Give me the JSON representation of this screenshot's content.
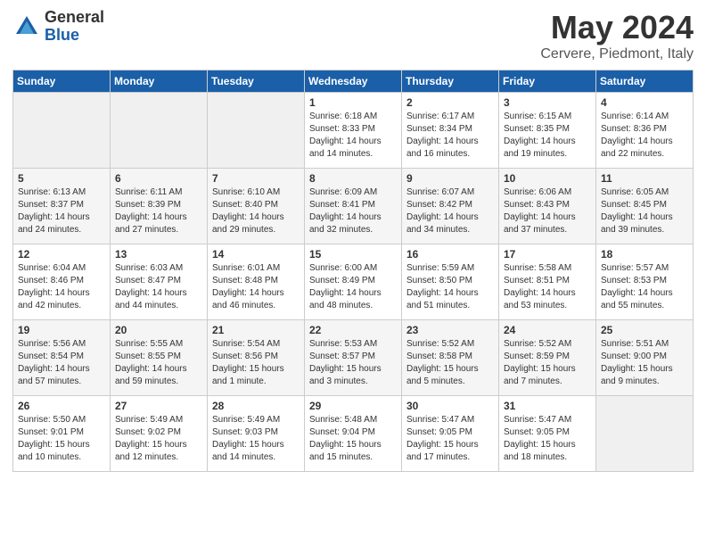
{
  "logo": {
    "general": "General",
    "blue": "Blue"
  },
  "header": {
    "month": "May 2024",
    "location": "Cervere, Piedmont, Italy"
  },
  "weekdays": [
    "Sunday",
    "Monday",
    "Tuesday",
    "Wednesday",
    "Thursday",
    "Friday",
    "Saturday"
  ],
  "weeks": [
    [
      {
        "day": "",
        "sunrise": "",
        "sunset": "",
        "daylight": "",
        "empty": true
      },
      {
        "day": "",
        "sunrise": "",
        "sunset": "",
        "daylight": "",
        "empty": true
      },
      {
        "day": "",
        "sunrise": "",
        "sunset": "",
        "daylight": "",
        "empty": true
      },
      {
        "day": "1",
        "sunrise": "Sunrise: 6:18 AM",
        "sunset": "Sunset: 8:33 PM",
        "daylight": "Daylight: 14 hours and 14 minutes."
      },
      {
        "day": "2",
        "sunrise": "Sunrise: 6:17 AM",
        "sunset": "Sunset: 8:34 PM",
        "daylight": "Daylight: 14 hours and 16 minutes."
      },
      {
        "day": "3",
        "sunrise": "Sunrise: 6:15 AM",
        "sunset": "Sunset: 8:35 PM",
        "daylight": "Daylight: 14 hours and 19 minutes."
      },
      {
        "day": "4",
        "sunrise": "Sunrise: 6:14 AM",
        "sunset": "Sunset: 8:36 PM",
        "daylight": "Daylight: 14 hours and 22 minutes."
      }
    ],
    [
      {
        "day": "5",
        "sunrise": "Sunrise: 6:13 AM",
        "sunset": "Sunset: 8:37 PM",
        "daylight": "Daylight: 14 hours and 24 minutes."
      },
      {
        "day": "6",
        "sunrise": "Sunrise: 6:11 AM",
        "sunset": "Sunset: 8:39 PM",
        "daylight": "Daylight: 14 hours and 27 minutes."
      },
      {
        "day": "7",
        "sunrise": "Sunrise: 6:10 AM",
        "sunset": "Sunset: 8:40 PM",
        "daylight": "Daylight: 14 hours and 29 minutes."
      },
      {
        "day": "8",
        "sunrise": "Sunrise: 6:09 AM",
        "sunset": "Sunset: 8:41 PM",
        "daylight": "Daylight: 14 hours and 32 minutes."
      },
      {
        "day": "9",
        "sunrise": "Sunrise: 6:07 AM",
        "sunset": "Sunset: 8:42 PM",
        "daylight": "Daylight: 14 hours and 34 minutes."
      },
      {
        "day": "10",
        "sunrise": "Sunrise: 6:06 AM",
        "sunset": "Sunset: 8:43 PM",
        "daylight": "Daylight: 14 hours and 37 minutes."
      },
      {
        "day": "11",
        "sunrise": "Sunrise: 6:05 AM",
        "sunset": "Sunset: 8:45 PM",
        "daylight": "Daylight: 14 hours and 39 minutes."
      }
    ],
    [
      {
        "day": "12",
        "sunrise": "Sunrise: 6:04 AM",
        "sunset": "Sunset: 8:46 PM",
        "daylight": "Daylight: 14 hours and 42 minutes."
      },
      {
        "day": "13",
        "sunrise": "Sunrise: 6:03 AM",
        "sunset": "Sunset: 8:47 PM",
        "daylight": "Daylight: 14 hours and 44 minutes."
      },
      {
        "day": "14",
        "sunrise": "Sunrise: 6:01 AM",
        "sunset": "Sunset: 8:48 PM",
        "daylight": "Daylight: 14 hours and 46 minutes."
      },
      {
        "day": "15",
        "sunrise": "Sunrise: 6:00 AM",
        "sunset": "Sunset: 8:49 PM",
        "daylight": "Daylight: 14 hours and 48 minutes."
      },
      {
        "day": "16",
        "sunrise": "Sunrise: 5:59 AM",
        "sunset": "Sunset: 8:50 PM",
        "daylight": "Daylight: 14 hours and 51 minutes."
      },
      {
        "day": "17",
        "sunrise": "Sunrise: 5:58 AM",
        "sunset": "Sunset: 8:51 PM",
        "daylight": "Daylight: 14 hours and 53 minutes."
      },
      {
        "day": "18",
        "sunrise": "Sunrise: 5:57 AM",
        "sunset": "Sunset: 8:53 PM",
        "daylight": "Daylight: 14 hours and 55 minutes."
      }
    ],
    [
      {
        "day": "19",
        "sunrise": "Sunrise: 5:56 AM",
        "sunset": "Sunset: 8:54 PM",
        "daylight": "Daylight: 14 hours and 57 minutes."
      },
      {
        "day": "20",
        "sunrise": "Sunrise: 5:55 AM",
        "sunset": "Sunset: 8:55 PM",
        "daylight": "Daylight: 14 hours and 59 minutes."
      },
      {
        "day": "21",
        "sunrise": "Sunrise: 5:54 AM",
        "sunset": "Sunset: 8:56 PM",
        "daylight": "Daylight: 15 hours and 1 minute."
      },
      {
        "day": "22",
        "sunrise": "Sunrise: 5:53 AM",
        "sunset": "Sunset: 8:57 PM",
        "daylight": "Daylight: 15 hours and 3 minutes."
      },
      {
        "day": "23",
        "sunrise": "Sunrise: 5:52 AM",
        "sunset": "Sunset: 8:58 PM",
        "daylight": "Daylight: 15 hours and 5 minutes."
      },
      {
        "day": "24",
        "sunrise": "Sunrise: 5:52 AM",
        "sunset": "Sunset: 8:59 PM",
        "daylight": "Daylight: 15 hours and 7 minutes."
      },
      {
        "day": "25",
        "sunrise": "Sunrise: 5:51 AM",
        "sunset": "Sunset: 9:00 PM",
        "daylight": "Daylight: 15 hours and 9 minutes."
      }
    ],
    [
      {
        "day": "26",
        "sunrise": "Sunrise: 5:50 AM",
        "sunset": "Sunset: 9:01 PM",
        "daylight": "Daylight: 15 hours and 10 minutes."
      },
      {
        "day": "27",
        "sunrise": "Sunrise: 5:49 AM",
        "sunset": "Sunset: 9:02 PM",
        "daylight": "Daylight: 15 hours and 12 minutes."
      },
      {
        "day": "28",
        "sunrise": "Sunrise: 5:49 AM",
        "sunset": "Sunset: 9:03 PM",
        "daylight": "Daylight: 15 hours and 14 minutes."
      },
      {
        "day": "29",
        "sunrise": "Sunrise: 5:48 AM",
        "sunset": "Sunset: 9:04 PM",
        "daylight": "Daylight: 15 hours and 15 minutes."
      },
      {
        "day": "30",
        "sunrise": "Sunrise: 5:47 AM",
        "sunset": "Sunset: 9:05 PM",
        "daylight": "Daylight: 15 hours and 17 minutes."
      },
      {
        "day": "31",
        "sunrise": "Sunrise: 5:47 AM",
        "sunset": "Sunset: 9:05 PM",
        "daylight": "Daylight: 15 hours and 18 minutes."
      },
      {
        "day": "",
        "sunrise": "",
        "sunset": "",
        "daylight": "",
        "empty": true
      }
    ]
  ]
}
